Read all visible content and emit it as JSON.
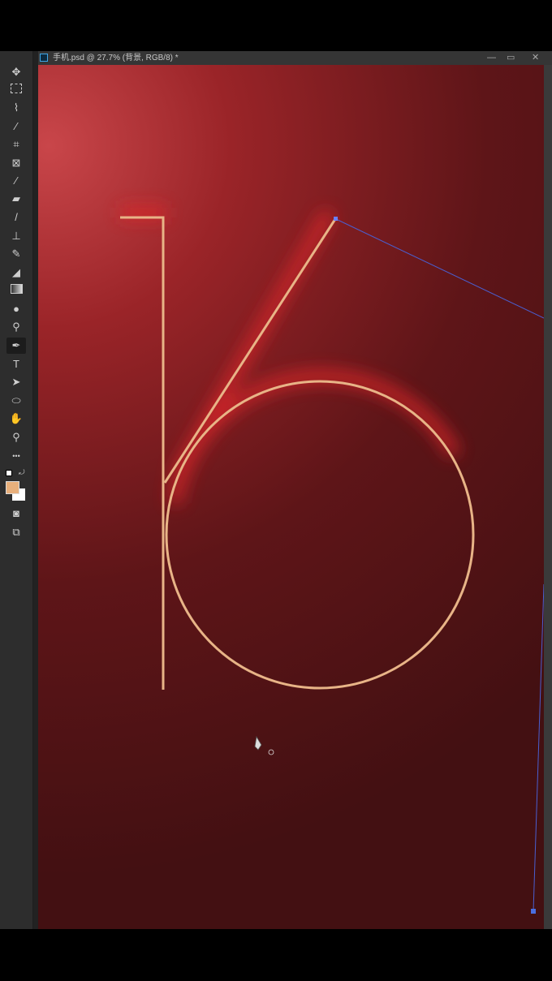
{
  "window": {
    "title": "手机.psd @ 27.7% (背景, RGB/8) *",
    "controls": [
      "minimize",
      "maximize",
      "close"
    ]
  },
  "toolbar": {
    "tools": [
      "move-tool",
      "marquee-tool",
      "lasso-tool",
      "magic-wand-tool",
      "crop-tool",
      "frame-tool",
      "eyedropper-tool",
      "healing-brush-tool",
      "brush-tool",
      "clone-stamp-tool",
      "history-brush-tool",
      "eraser-tool",
      "gradient-tool",
      "blur-tool",
      "dodge-tool",
      "pen-tool",
      "type-tool",
      "path-selection-tool",
      "ellipse-tool",
      "hand-tool",
      "zoom-tool",
      "more-tools"
    ],
    "active": "pen-tool",
    "type_glyph": "T",
    "more_glyph": "•••"
  },
  "colors": {
    "foreground": "#e8b07c",
    "background": "#ffffff",
    "canvas": "#5a1518",
    "stroke": "#e8b487",
    "path": "#4a5fd0"
  }
}
